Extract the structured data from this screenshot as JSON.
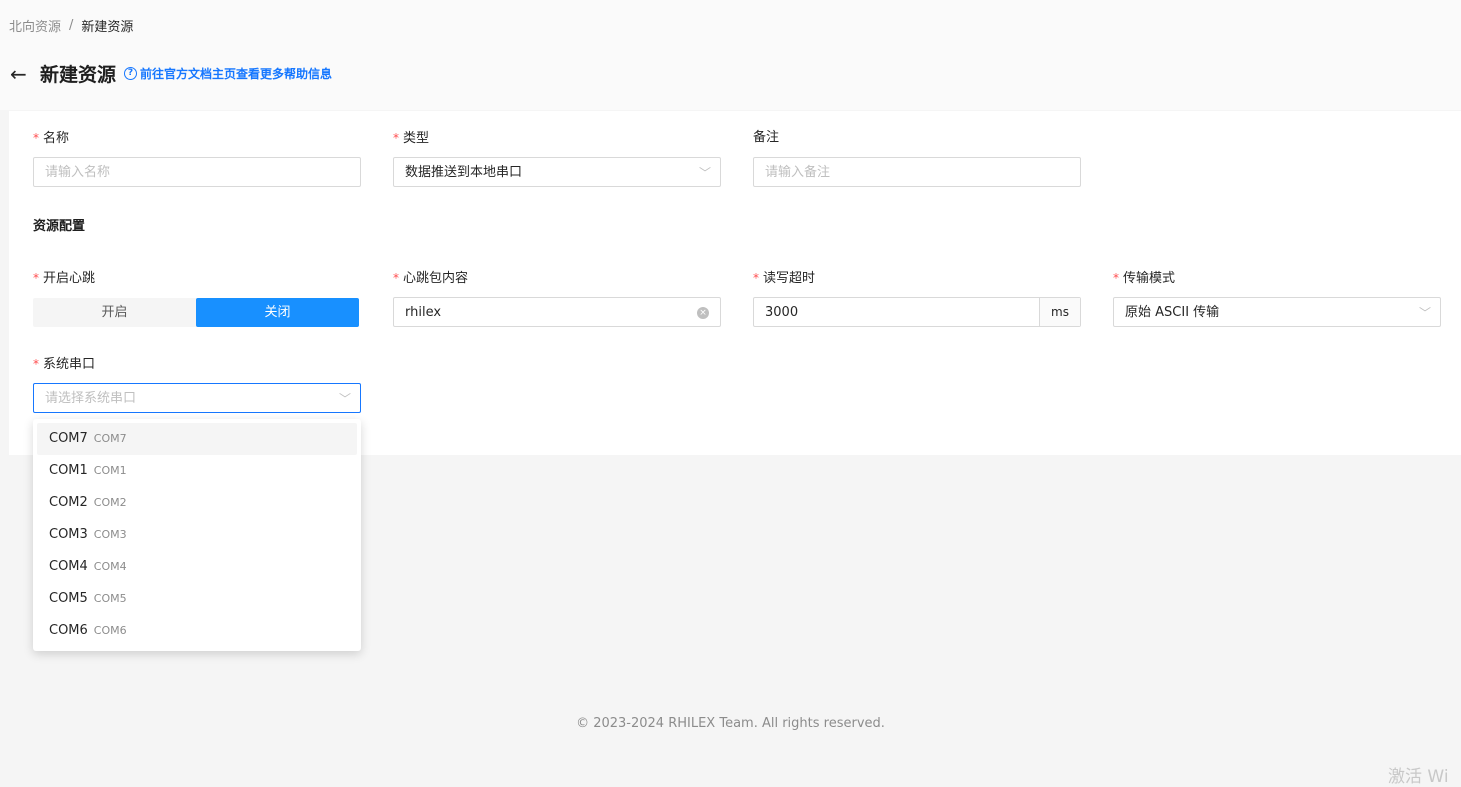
{
  "breadcrumb": {
    "parent": "北向资源",
    "separator": "/",
    "current": "新建资源"
  },
  "header": {
    "title": "新建资源",
    "help_text": "前往官方文档主页查看更多帮助信息",
    "help_icon": "?"
  },
  "form": {
    "name": {
      "label": "名称",
      "required": "*",
      "placeholder": "请输入名称"
    },
    "type": {
      "label": "类型",
      "required": "*",
      "value": "数据推送到本地串口"
    },
    "remark": {
      "label": "备注",
      "placeholder": "请输入备注"
    }
  },
  "config": {
    "section_title": "资源配置",
    "heartbeat": {
      "label": "开启心跳",
      "required": "*",
      "on": "开启",
      "off": "关闭",
      "selected": "关闭"
    },
    "heartbeat_content": {
      "label": "心跳包内容",
      "required": "*",
      "value": "rhilex"
    },
    "timeout": {
      "label": "读写超时",
      "required": "*",
      "value": "3000",
      "unit": "ms"
    },
    "transfer_mode": {
      "label": "传输模式",
      "required": "*",
      "value": "原始 ASCII 传输"
    },
    "serial_port": {
      "label": "系统串口",
      "required": "*",
      "placeholder": "请选择系统串口"
    }
  },
  "dropdown": {
    "options": [
      {
        "label": "COM7",
        "sub": "COM7"
      },
      {
        "label": "COM1",
        "sub": "COM1"
      },
      {
        "label": "COM2",
        "sub": "COM2"
      },
      {
        "label": "COM3",
        "sub": "COM3"
      },
      {
        "label": "COM4",
        "sub": "COM4"
      },
      {
        "label": "COM5",
        "sub": "COM5"
      },
      {
        "label": "COM6",
        "sub": "COM6"
      }
    ]
  },
  "footer": {
    "copyright": "© 2023-2024 RHILEX Team. All rights reserved."
  },
  "watermark": "激活 Wi",
  "colors": {
    "primary": "#1890ff",
    "required": "#ff4d4f",
    "link": "#1677ff"
  },
  "icons": {
    "back": "arrow-left-icon",
    "chevron": "chevron-down-icon",
    "clear": "close-circle-icon"
  }
}
